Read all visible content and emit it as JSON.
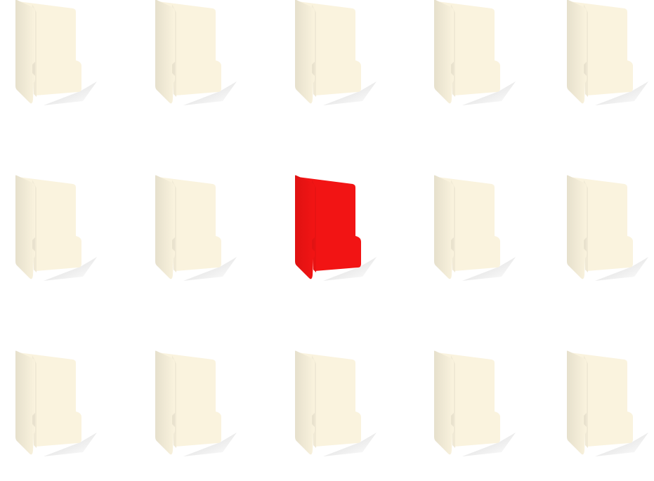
{
  "grid": {
    "rows": 3,
    "columns": 5
  },
  "folders": {
    "icon": "folder-icon",
    "default_color": "#FAF3DE",
    "highlight_color": "#F21414",
    "highlighted": {
      "row": 2,
      "column": 3
    }
  }
}
